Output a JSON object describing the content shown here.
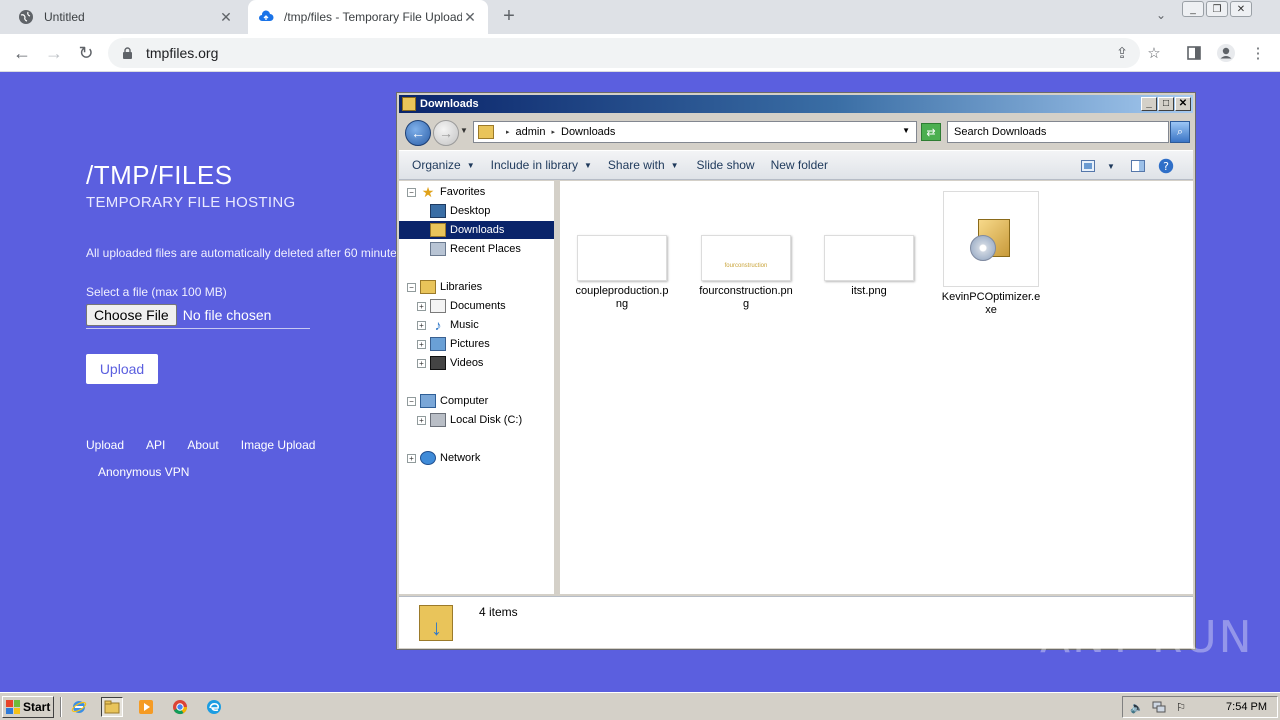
{
  "browser": {
    "tabs": [
      {
        "title": "Untitled",
        "active": false
      },
      {
        "title": "/tmp/files - Temporary File Upload",
        "active": true
      }
    ],
    "url": "tmpfiles.org"
  },
  "site": {
    "title": "/TMP/FILES",
    "subtitle": "TEMPORARY FILE HOSTING",
    "notice": "All uploaded files are automatically deleted after 60 minutes.",
    "file_label": "Select a file (max 100 MB)",
    "choose_file": "Choose File",
    "no_file": "No file chosen",
    "upload": "Upload",
    "footer_links": [
      "Upload",
      "API",
      "About",
      "Image Upload"
    ],
    "vpn_link": "Anonymous VPN"
  },
  "explorer": {
    "title": "Downloads",
    "path": [
      "admin",
      "Downloads"
    ],
    "search_placeholder": "Search Downloads",
    "commands": [
      "Organize",
      "Include in library",
      "Share with",
      "Slide show",
      "New folder"
    ],
    "nav": {
      "favorites": "Favorites",
      "desktop": "Desktop",
      "downloads": "Downloads",
      "recent": "Recent Places",
      "libraries": "Libraries",
      "documents": "Documents",
      "music": "Music",
      "pictures": "Pictures",
      "videos": "Videos",
      "computer": "Computer",
      "local_disk": "Local Disk (C:)",
      "network": "Network"
    },
    "files": [
      {
        "name": "coupleproduction.png",
        "label_lines": [
          "coupleproduction.p",
          "ng"
        ],
        "thumb_text": ""
      },
      {
        "name": "fourconstruction.png",
        "label_lines": [
          "fourconstruction.pn",
          "g"
        ],
        "thumb_text": "fourconstruction"
      },
      {
        "name": "itst.png",
        "label_lines": [
          "itst.png"
        ],
        "thumb_text": ""
      },
      {
        "name": "KevinPCOptimizer.exe",
        "label_lines": [
          "KevinPCOptimizer.e",
          "xe"
        ],
        "thumb_text": ""
      }
    ],
    "status": "4 items"
  },
  "watermark": "ANY RUN",
  "taskbar": {
    "start": "Start",
    "clock": "7:54 PM"
  },
  "colors": {
    "page_bg": "#5b5fdf",
    "explorer_title": "#0a246a",
    "selection": "#0a246a"
  }
}
